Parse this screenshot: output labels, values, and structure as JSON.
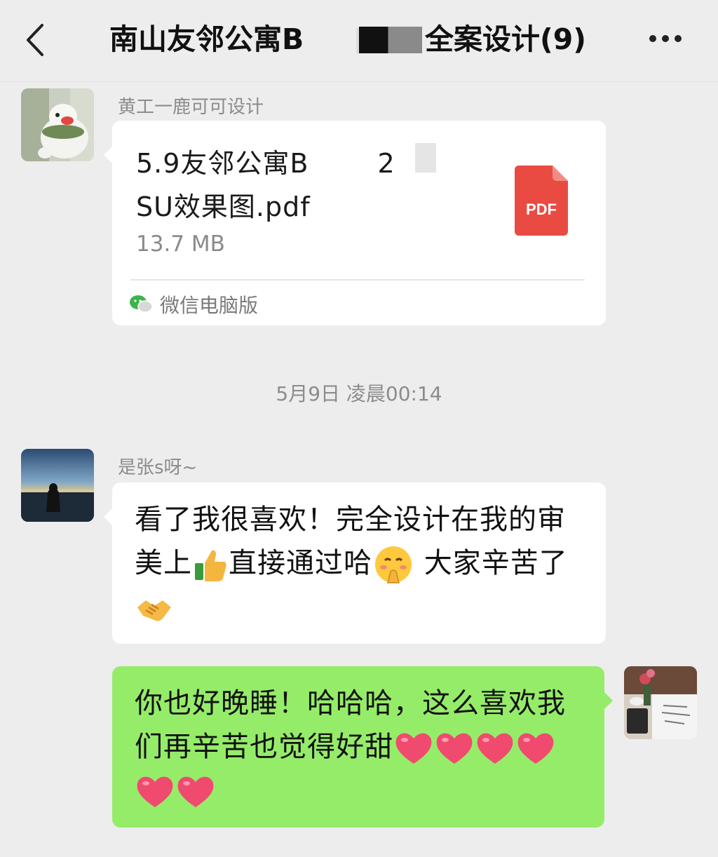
{
  "header": {
    "title_start": "南山友邻公寓B",
    "title_end": "全案设计(9)"
  },
  "messages": [
    {
      "sender": "黄工一鹿可可设计",
      "type": "file",
      "file_name_line1": "5.9友邻公寓B",
      "file_name_line1_tail": "2",
      "file_name_line2": "SU效果图.pdf",
      "file_size": "13.7 MB",
      "file_type_label": "PDF",
      "source": "微信电脑版"
    },
    {
      "sender": "是张s呀~",
      "type": "text",
      "text_part1": "看了我很喜欢！完全设计在我的审美上",
      "text_part2": "直接通过哈",
      "text_part3": " 大家辛苦了"
    },
    {
      "type": "text",
      "outgoing": true,
      "text": "你也好晚睡！哈哈哈，这么喜欢我们再辛苦也觉得好甜"
    }
  ],
  "timestamp": "5月9日 凌晨00:14",
  "colors": {
    "background": "#ededed",
    "bubble_in": "#ffffff",
    "bubble_out": "#95ec69",
    "pdf_red": "#e94b43",
    "heart": "#f04a6e"
  },
  "icons": [
    "back-arrow-icon",
    "more-icon",
    "pdf-file-icon",
    "wechat-icon",
    "thumbs-up-emoji",
    "shy-face-emoji",
    "handshake-emoji",
    "heart-emoji"
  ]
}
